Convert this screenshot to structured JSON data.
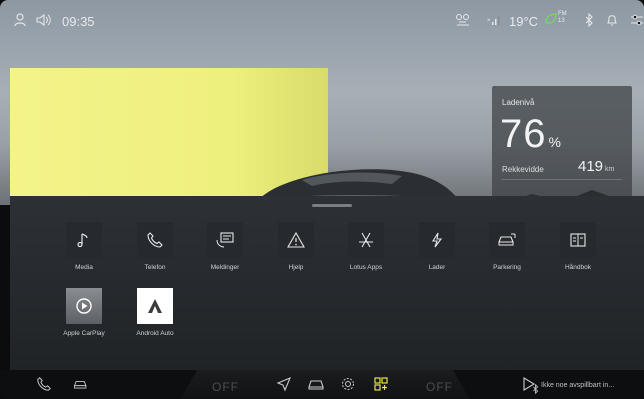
{
  "status_bar": {
    "time": "09:35",
    "temperature": "19°C",
    "fm_badge": "FM",
    "fm_sub": "13"
  },
  "battery_card": {
    "label": "Ladenivå",
    "percent": "76",
    "percent_unit": "%",
    "range_label": "Rekkevidde",
    "range_value": "419",
    "range_unit": "km"
  },
  "apps": [
    {
      "label": "Media",
      "icon": "music-note-icon"
    },
    {
      "label": "Telefon",
      "icon": "phone-icon"
    },
    {
      "label": "Meldinger",
      "icon": "message-icon"
    },
    {
      "label": "Hjelp",
      "icon": "warning-icon"
    },
    {
      "label": "Lotus Apps",
      "icon": "app-store-icon"
    },
    {
      "label": "Lader",
      "icon": "lightning-icon"
    },
    {
      "label": "Parkering",
      "icon": "parking-icon"
    },
    {
      "label": "Håndbok",
      "icon": "book-icon"
    },
    {
      "label": "Apple CarPlay",
      "icon": "carplay-icon"
    },
    {
      "label": "Android Auto",
      "icon": "android-auto-icon"
    }
  ],
  "bottom_bar": {
    "left_off": "OFF",
    "right_off": "OFF",
    "media_text": "Ikke noe avspillbart in..."
  },
  "colors": {
    "accent_yellow": "#e9e24a",
    "wall_yellow": "#f0f17f",
    "battery_leaf_green": "#6fdc5c"
  }
}
